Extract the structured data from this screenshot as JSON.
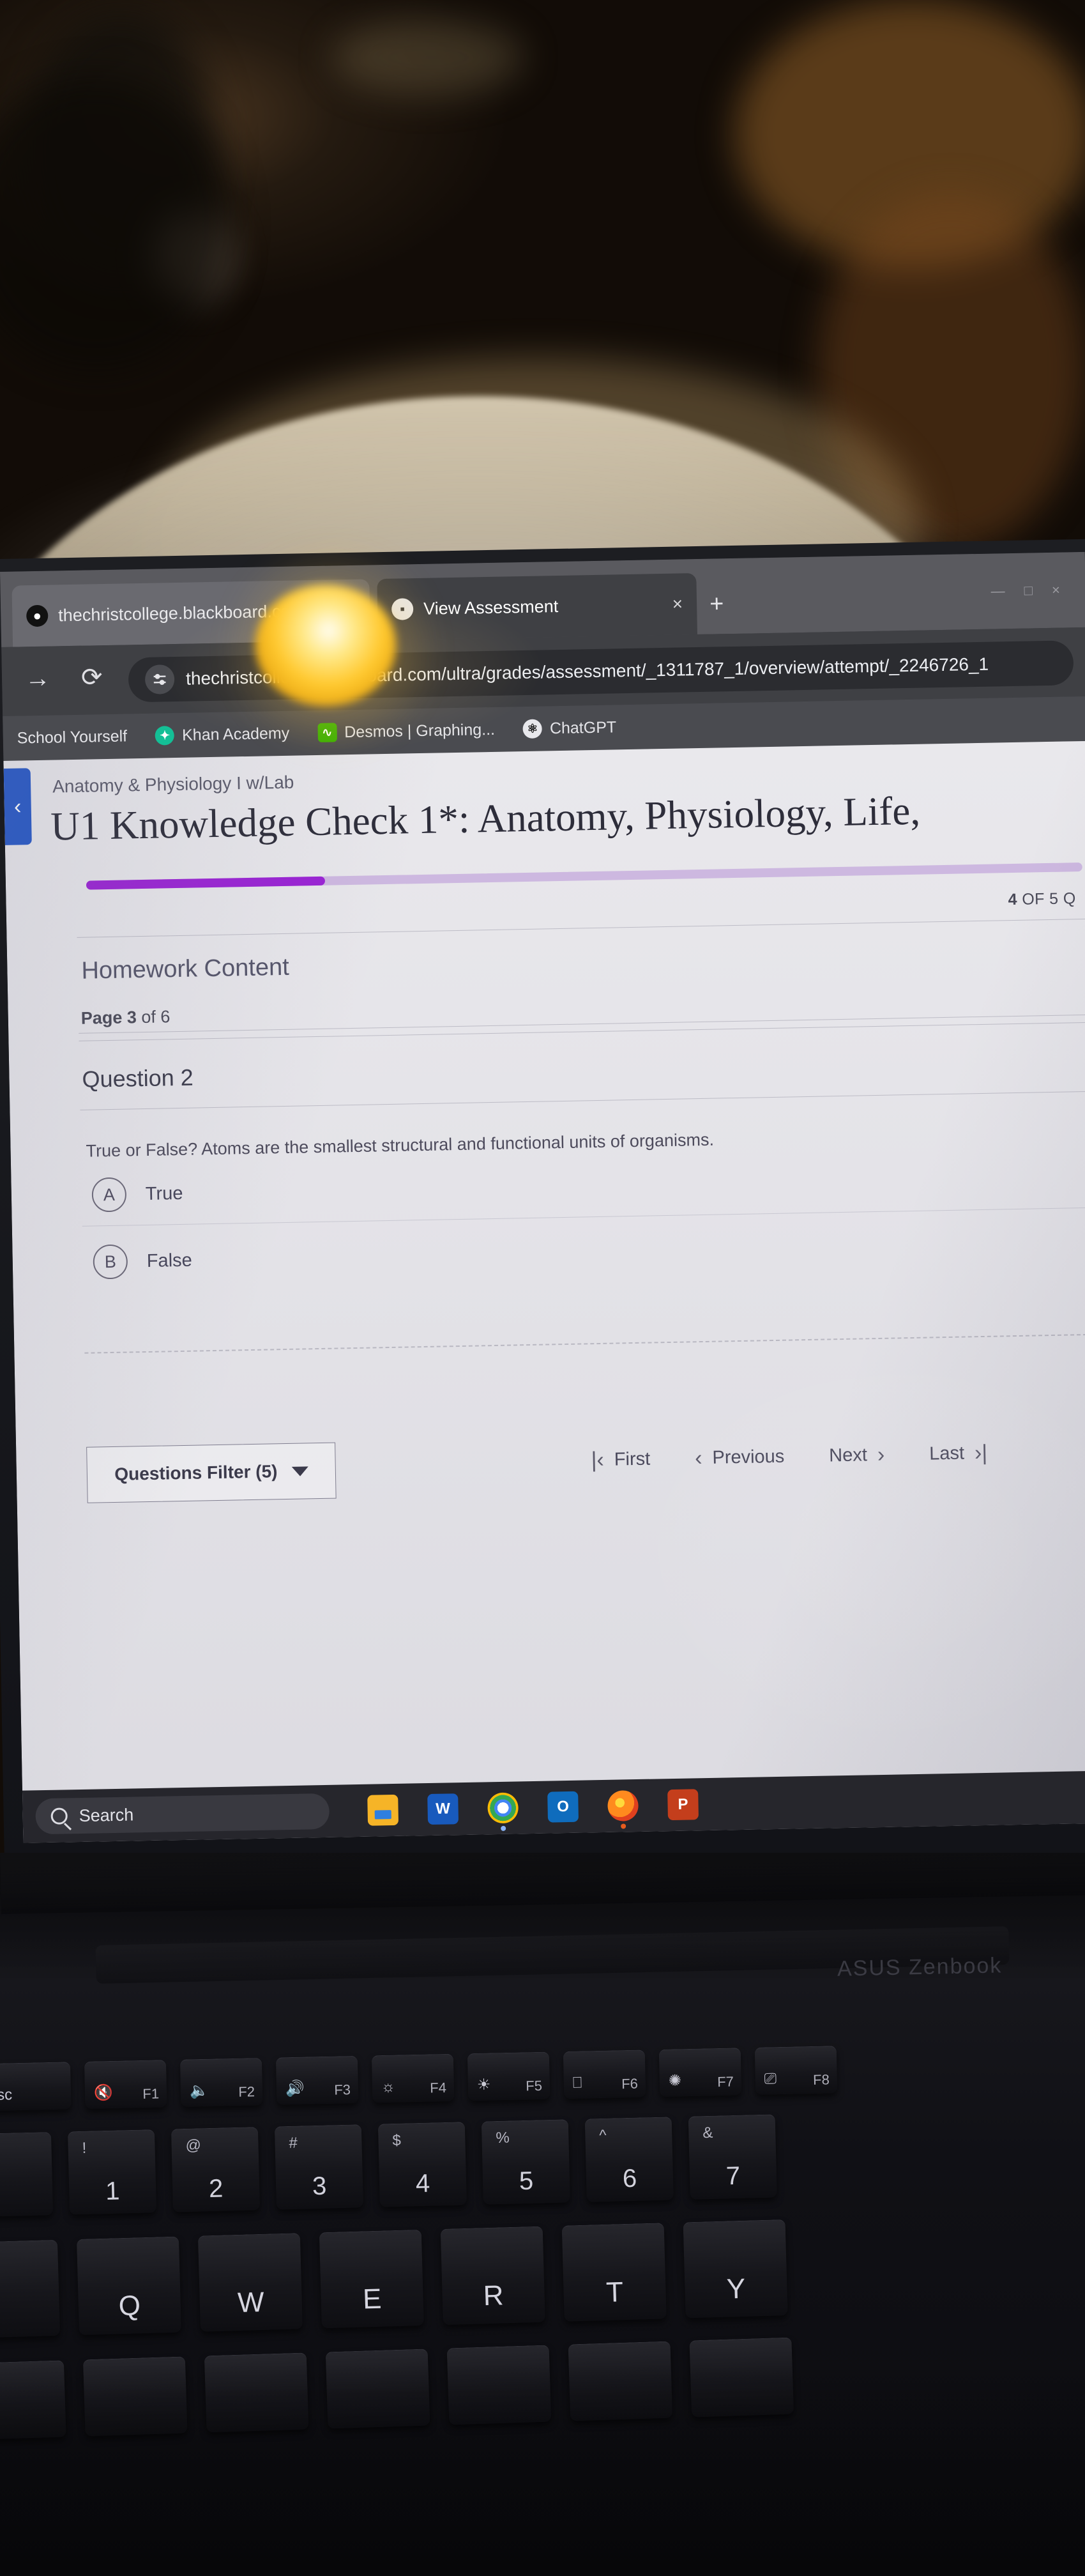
{
  "browser": {
    "tabs": [
      {
        "title": "thechristcollege.blackboard.co",
        "favicon": "blackboard-icon",
        "active": false
      },
      {
        "title": "View Assessment",
        "favicon": "bar-chart-icon",
        "active": true,
        "close": "×"
      }
    ],
    "new_tab_label": "+",
    "window_controls": [
      "—",
      "□",
      "×"
    ],
    "nav": {
      "forward_icon": "→",
      "reload_icon": "⟳",
      "site_settings_icon": "sliders-icon"
    },
    "url": "thechristcollege.blackboard.com/ultra/grades/assessment/_1311787_1/overview/attempt/_2246726_1",
    "bookmarks": [
      {
        "label": "School Yourself",
        "icon": ""
      },
      {
        "label": "Khan Academy",
        "icon": "khan-academy-icon",
        "color": "#14BF96"
      },
      {
        "label": "Desmos | Graphing...",
        "icon": "desmos-icon",
        "color": "#38B000"
      },
      {
        "label": "ChatGPT",
        "icon": "chatgpt-icon",
        "color": "#E8E8EC"
      }
    ]
  },
  "assessment": {
    "back_icon": "‹",
    "breadcrumb": "Anatomy & Physiology I w/Lab",
    "title": "U1 Knowledge Check 1*: Anatomy, Physiology, Life,",
    "progress_percent": 24,
    "progress_color": "#9A23D4",
    "question_counter_current": "4",
    "question_counter_rest": " OF 5 Q",
    "section_title": "Homework Content",
    "page_label_bold": "Page 3",
    "page_label_rest": " of 6",
    "question_number": "Question 2",
    "question_text": "True or False? Atoms are the smallest structural and functional units of organisms.",
    "options": [
      {
        "badge": "A",
        "label": "True"
      },
      {
        "badge": "B",
        "label": "False"
      }
    ],
    "footer": {
      "filter_label": "Questions Filter (5)",
      "filter_caret": "caret-down-icon",
      "pager": [
        {
          "label": "First",
          "glyph": "|‹",
          "side": "left"
        },
        {
          "label": "Previous",
          "glyph": "‹",
          "side": "left"
        },
        {
          "label": "Next",
          "glyph": "›",
          "side": "right"
        },
        {
          "label": "Last",
          "glyph": "›|",
          "side": "right"
        }
      ]
    }
  },
  "taskbar": {
    "search_placeholder": "Search",
    "search_icon": "magnifier-icon",
    "apps": [
      {
        "name": "file-explorer-icon",
        "glyph": "",
        "color": "#F6B427",
        "dot": ""
      },
      {
        "name": "word-icon",
        "glyph": "W",
        "color": "#185ABD",
        "dot": ""
      },
      {
        "name": "chrome-icon",
        "glyph": "",
        "color": "#FFFFFF",
        "dot": "#8AB4F8"
      },
      {
        "name": "outlook-icon",
        "glyph": "O",
        "color": "#0F6CBD",
        "dot": ""
      },
      {
        "name": "firefox-icon",
        "glyph": "",
        "color": "#E55B1E",
        "dot": "#E55B1E"
      },
      {
        "name": "powerpoint-icon",
        "glyph": "P",
        "color": "#C43E1C",
        "dot": "#C43E1C"
      }
    ]
  },
  "laptop": {
    "brand": "ASUS Zenbook",
    "function_keys": [
      {
        "fn": "",
        "icon": "esc-label",
        "label": "sc"
      },
      {
        "fn": "F1",
        "icon": "mute-icon",
        "label": ""
      },
      {
        "fn": "F2",
        "icon": "volume-down-icon",
        "label": ""
      },
      {
        "fn": "F3",
        "icon": "volume-up-icon",
        "label": ""
      },
      {
        "fn": "F4",
        "icon": "brightness-down-icon",
        "label": ""
      },
      {
        "fn": "F5",
        "icon": "brightness-up-icon",
        "label": ""
      },
      {
        "fn": "F6",
        "icon": "touchpad-icon",
        "label": ""
      },
      {
        "fn": "F7",
        "icon": "keyboard-light-icon",
        "label": ""
      },
      {
        "fn": "F8",
        "icon": "display-switch-icon",
        "label": ""
      }
    ],
    "number_row": [
      {
        "sym": "`",
        "num": ""
      },
      {
        "sym": "!",
        "num": "1"
      },
      {
        "sym": "@",
        "num": "2"
      },
      {
        "sym": "#",
        "num": "3"
      },
      {
        "sym": "$",
        "num": "4"
      },
      {
        "sym": "%",
        "num": "5"
      },
      {
        "sym": "^",
        "num": "6"
      },
      {
        "sym": "&",
        "num": "7"
      }
    ],
    "letter_row": [
      "Q",
      "W",
      "E",
      "R",
      "T",
      "Y"
    ]
  }
}
